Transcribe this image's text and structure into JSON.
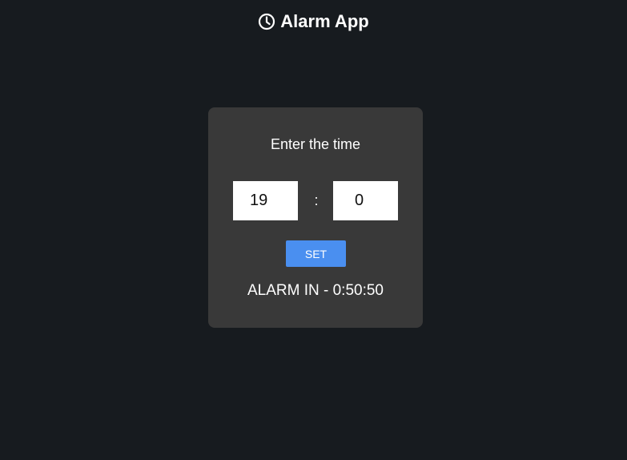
{
  "header": {
    "icon": "clock-icon",
    "title": "Alarm App"
  },
  "card": {
    "prompt": "Enter the time",
    "hours_value": "19",
    "separator": ":",
    "minutes_value": "0",
    "set_label": "SET",
    "status_text": "ALARM IN - 0:50:50"
  },
  "colors": {
    "background": "#171b1f",
    "card": "#393939",
    "accent": "#4a8ff0",
    "text": "#ffffff"
  }
}
